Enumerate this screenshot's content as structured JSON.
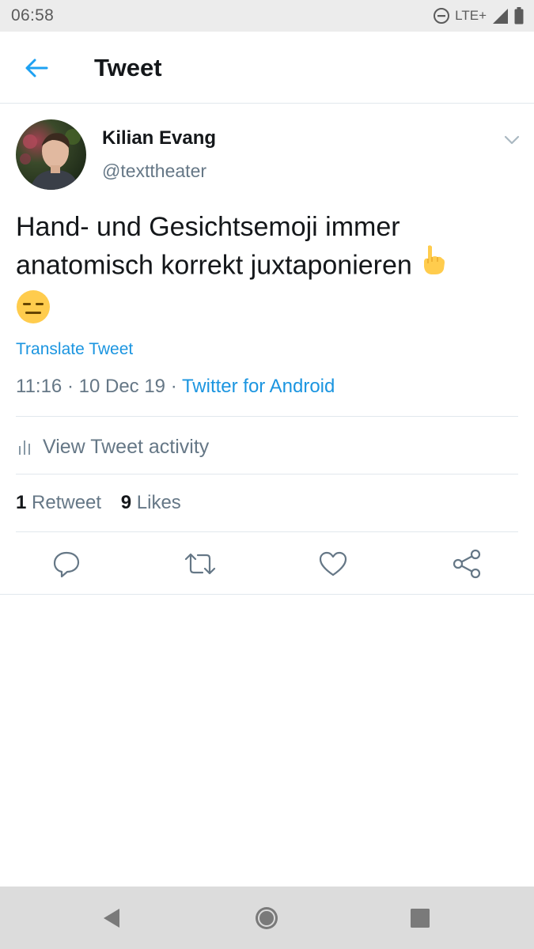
{
  "status_bar": {
    "time": "06:58",
    "network": "LTE+",
    "icons": [
      "do-not-disturb-icon",
      "signal-icon",
      "battery-icon"
    ]
  },
  "app_bar": {
    "title": "Tweet",
    "back_icon": "arrow-left-icon"
  },
  "tweet": {
    "author": {
      "display_name": "Kilian Evang",
      "handle": "@texttheater"
    },
    "text_line1": "Hand- und Gesichtsemoji immer",
    "text_line2": "anatomisch korrekt juxtaponieren",
    "emojis": [
      "pointing-up-emoji",
      "expressionless-face-emoji"
    ],
    "translate_label": "Translate Tweet",
    "time": "11:16",
    "date": "10 Dec 19",
    "separator": "·",
    "source": "Twitter for Android",
    "activity_label": "View Tweet activity",
    "retweet_count": "1",
    "retweet_label": "Retweet",
    "like_count": "9",
    "like_label": "Likes",
    "actions": [
      "reply-icon",
      "retweet-icon",
      "like-icon",
      "share-icon"
    ]
  },
  "colors": {
    "accent": "#1da1f2",
    "link": "#1b95e0",
    "secondary_text": "#657786",
    "primary_text": "#14171a",
    "divider": "#e1e8ed"
  },
  "nav_bar": {
    "buttons": [
      "back-triangle-icon",
      "home-circle-icon",
      "recents-square-icon"
    ]
  }
}
